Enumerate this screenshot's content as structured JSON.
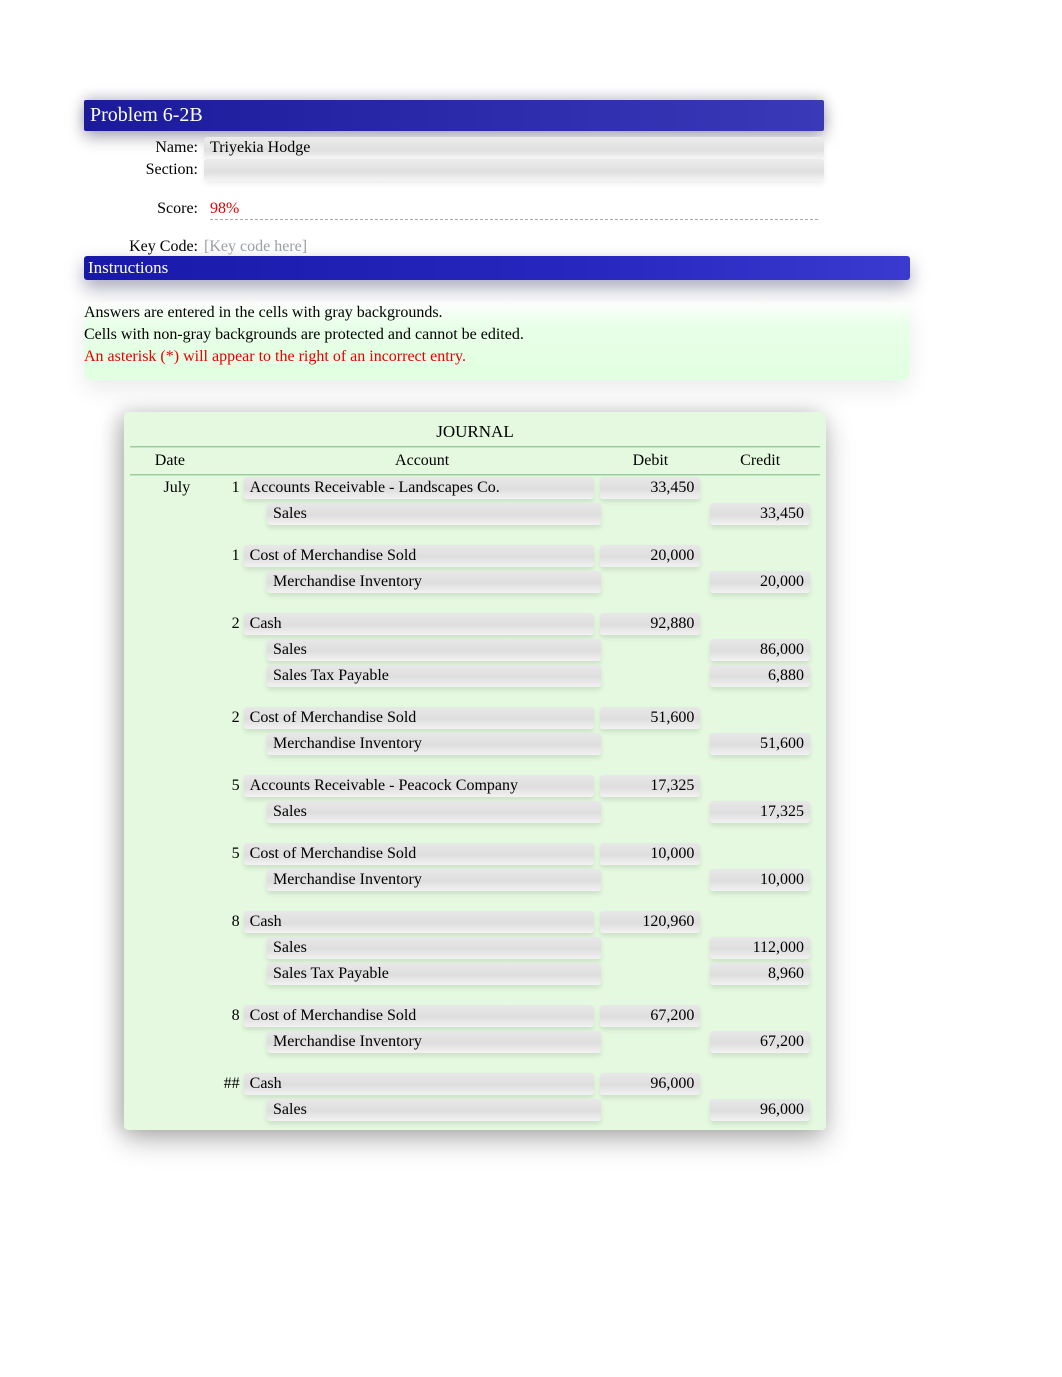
{
  "header": {
    "title": "Problem 6-2B"
  },
  "info": {
    "name_label": "Name:",
    "name_value": "Triyekia Hodge",
    "section_label": "Section:",
    "section_value": "",
    "score_label": "Score:",
    "score_value": "98%",
    "keycode_label": "Key Code:",
    "keycode_placeholder": "[Key code here]"
  },
  "instructions": {
    "bar": "Instructions",
    "line1": "Answers are entered in the cells with gray backgrounds.",
    "line2": "Cells with non-gray backgrounds are protected and cannot be edited.",
    "line3": "An asterisk (*) will appear to the right of an incorrect entry."
  },
  "journal": {
    "title": "JOURNAL",
    "cols": {
      "date": "Date",
      "account": "Account",
      "debit": "Debit",
      "credit": "Credit"
    },
    "month": "July",
    "entries": [
      {
        "day": "1",
        "show_month": true,
        "lines": [
          {
            "account": "Accounts Receivable - Landscapes Co.",
            "indent": false,
            "debit": "33,450",
            "credit": ""
          },
          {
            "account": "Sales",
            "indent": true,
            "debit": "",
            "credit": "33,450"
          }
        ]
      },
      {
        "day": "1",
        "lines": [
          {
            "account": "Cost of Merchandise Sold",
            "indent": false,
            "debit": "20,000",
            "credit": ""
          },
          {
            "account": "Merchandise Inventory",
            "indent": true,
            "debit": "",
            "credit": "20,000"
          }
        ]
      },
      {
        "day": "2",
        "lines": [
          {
            "account": "Cash",
            "indent": false,
            "debit": "92,880",
            "credit": ""
          },
          {
            "account": "Sales",
            "indent": true,
            "debit": "",
            "credit": "86,000"
          },
          {
            "account": "Sales Tax Payable",
            "indent": true,
            "debit": "",
            "credit": "6,880"
          }
        ]
      },
      {
        "day": "2",
        "lines": [
          {
            "account": "Cost of Merchandise Sold",
            "indent": false,
            "debit": "51,600",
            "credit": ""
          },
          {
            "account": "Merchandise Inventory",
            "indent": true,
            "debit": "",
            "credit": "51,600"
          }
        ]
      },
      {
        "day": "5",
        "lines": [
          {
            "account": "Accounts Receivable - Peacock Company",
            "indent": false,
            "debit": "17,325",
            "credit": ""
          },
          {
            "account": "Sales",
            "indent": true,
            "debit": "",
            "credit": "17,325"
          }
        ]
      },
      {
        "day": "5",
        "lines": [
          {
            "account": "Cost of Merchandise Sold",
            "indent": false,
            "debit": "10,000",
            "credit": ""
          },
          {
            "account": "Merchandise Inventory",
            "indent": true,
            "debit": "",
            "credit": "10,000"
          }
        ]
      },
      {
        "day": "8",
        "lines": [
          {
            "account": "Cash",
            "indent": false,
            "debit": "120,960",
            "credit": ""
          },
          {
            "account": "Sales",
            "indent": true,
            "debit": "",
            "credit": "112,000"
          },
          {
            "account": "Sales Tax Payable",
            "indent": true,
            "debit": "",
            "credit": "8,960"
          }
        ]
      },
      {
        "day": "8",
        "lines": [
          {
            "account": "Cost of Merchandise Sold",
            "indent": false,
            "debit": "67,200",
            "credit": ""
          },
          {
            "account": "Merchandise Inventory",
            "indent": true,
            "debit": "",
            "credit": "67,200"
          }
        ]
      },
      {
        "day": "##",
        "lines": [
          {
            "account": "Cash",
            "indent": false,
            "debit": "96,000",
            "credit": ""
          },
          {
            "account": "Sales",
            "indent": true,
            "debit": "",
            "credit": "96,000"
          }
        ]
      }
    ]
  }
}
